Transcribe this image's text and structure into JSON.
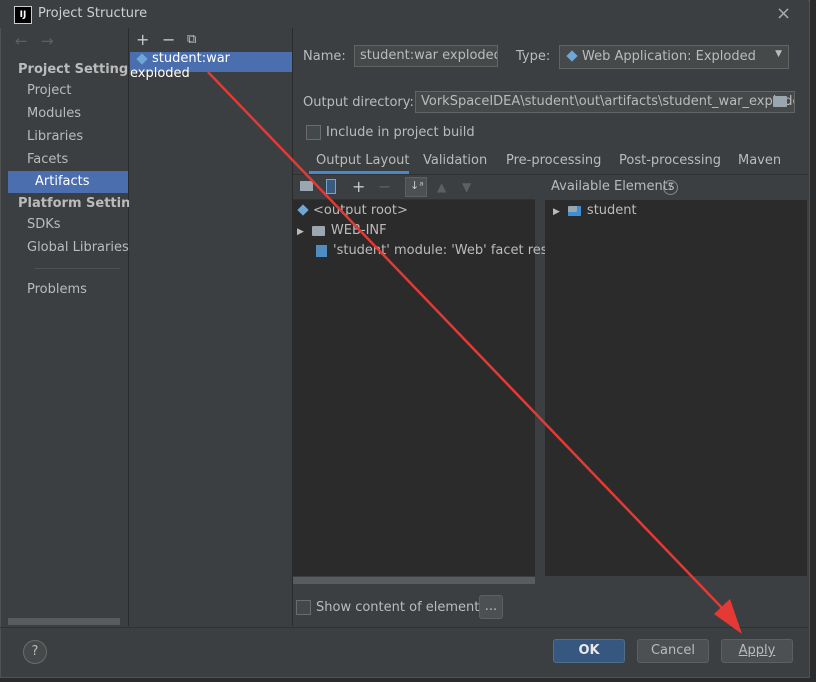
{
  "window": {
    "title": "Project Structure",
    "close": "×"
  },
  "nav": {
    "back": "←",
    "forward": "→",
    "project_settings": "Project Settings",
    "platform_settings": "Platform Settings",
    "items": [
      "Project",
      "Modules",
      "Libraries",
      "Facets",
      "Artifacts"
    ],
    "platform_items": [
      "SDKs",
      "Global Libraries"
    ],
    "problems": "Problems",
    "selected": "Artifacts"
  },
  "artifacts_toolbar": {
    "add": "+",
    "remove": "−",
    "copy": "⧉"
  },
  "artifacts_list": [
    "student:war exploded"
  ],
  "form": {
    "name_label": "Name:",
    "name_value": "student:war exploded",
    "type_label": "Type:",
    "type_value": "Web Application: Exploded",
    "output_dir_label": "Output directory:",
    "output_dir_value": "VorkSpaceIDEA\\student\\out\\artifacts\\student_war_exploded",
    "include_build_label": "Include in project build"
  },
  "tabs": [
    "Output Layout",
    "Validation",
    "Pre-processing",
    "Post-processing",
    "Maven"
  ],
  "active_tab": "Output Layout",
  "layout_tree": {
    "root": "<output root>",
    "folder": "WEB-INF",
    "module_resource": "'student' module: 'Web' facet resourc"
  },
  "available": {
    "label": "Available Elements",
    "help": "?",
    "items": [
      "student"
    ]
  },
  "show_content_label": "Show content of elements",
  "ellipsis_button": "...",
  "buttons": {
    "ok": "OK",
    "cancel": "Cancel",
    "apply": "Apply",
    "help": "?"
  },
  "colors": {
    "selection": "#4b6eaf",
    "arrow": "#e53935",
    "accent": "#4a88c7"
  }
}
